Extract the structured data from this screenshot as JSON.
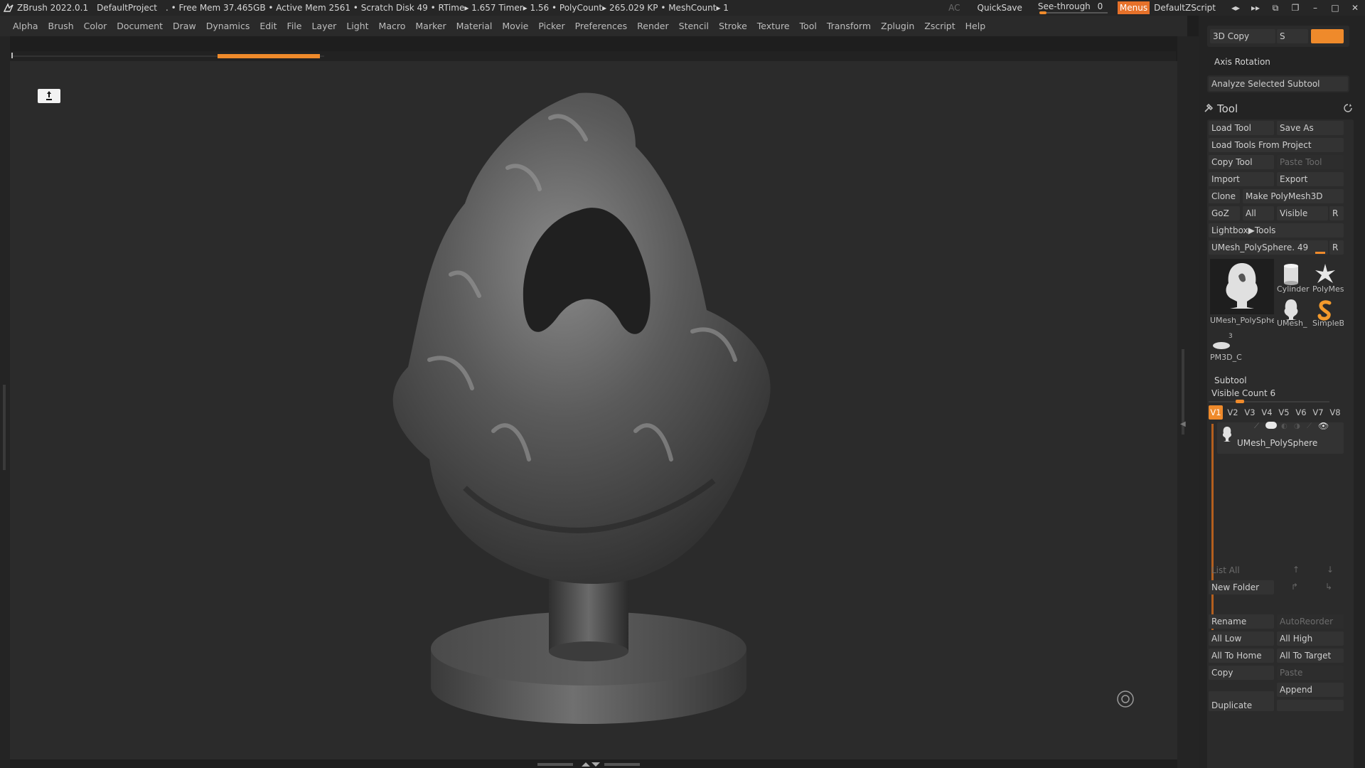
{
  "titlebar": {
    "app": "ZBrush 2022.0.1",
    "project": "DefaultProject",
    "stats": ". • Free Mem 37.465GB • Active Mem 2561 • Scratch Disk 49 •  RTime▸ 1.657 Timer▸ 1.56 • PolyCount▸ 265.029 KP  • MeshCount▸ 1",
    "ac": "AC",
    "quicksave": "QuickSave",
    "seethrough_label": "See-through",
    "seethrough_value": "0",
    "menus": "Menus",
    "zscript": "DefaultZScript"
  },
  "menubar": {
    "items": [
      "Alpha",
      "Brush",
      "Color",
      "Document",
      "Draw",
      "Dynamics",
      "Edit",
      "File",
      "Layer",
      "Light",
      "Macro",
      "Marker",
      "Material",
      "Movie",
      "Picker",
      "Preferences",
      "Render",
      "Stencil",
      "Stroke",
      "Texture",
      "Tool",
      "Transform",
      "Zplugin",
      "Zscript",
      "Help"
    ]
  },
  "panel": {
    "copy3d": "3D Copy",
    "s_label": "S",
    "axis_rotation": "Axis Rotation",
    "analyze": "Analyze Selected Subtool",
    "tool_title": "Tool",
    "load_tool": "Load Tool",
    "save_as": "Save As",
    "load_from_project": "Load Tools From Project",
    "copy_tool": "Copy Tool",
    "paste_tool": "Paste Tool",
    "import": "Import",
    "export": "Export",
    "clone": "Clone",
    "make_polymesh": "Make PolyMesh3D",
    "goz": "GoZ",
    "all": "All",
    "visible": "Visible",
    "r": "R",
    "lightbox_tools": "Lightbox▶Tools",
    "current_tool": "UMesh_PolySphere. 49",
    "thumbs": {
      "main": "UMesh_PolySphe",
      "cylinder": "Cylinder",
      "polymesh": "PolyMes",
      "umesh": "UMesh_",
      "simpleb": "SimpleB",
      "pm3d": "PM3D_C",
      "pm3d_count": "3"
    },
    "subtool_title": "Subtool",
    "visible_count": "Visible Count 6",
    "versions": [
      "V1",
      "V2",
      "V3",
      "V4",
      "V5",
      "V6",
      "V7",
      "V8"
    ],
    "subtool_name": "UMesh_PolySphere",
    "list_all": "List All",
    "new_folder": "New Folder",
    "rename": "Rename",
    "autoreorder": "AutoReorder",
    "all_low": "All Low",
    "all_high": "All High",
    "all_to_home": "All To Home",
    "all_to_target": "All To Target",
    "copy": "Copy",
    "paste": "Paste",
    "append": "Append",
    "duplicate": "Duplicate"
  },
  "colors": {
    "accent": "#ef8a2b",
    "background": "#2b2b2b",
    "panel": "#232323"
  }
}
